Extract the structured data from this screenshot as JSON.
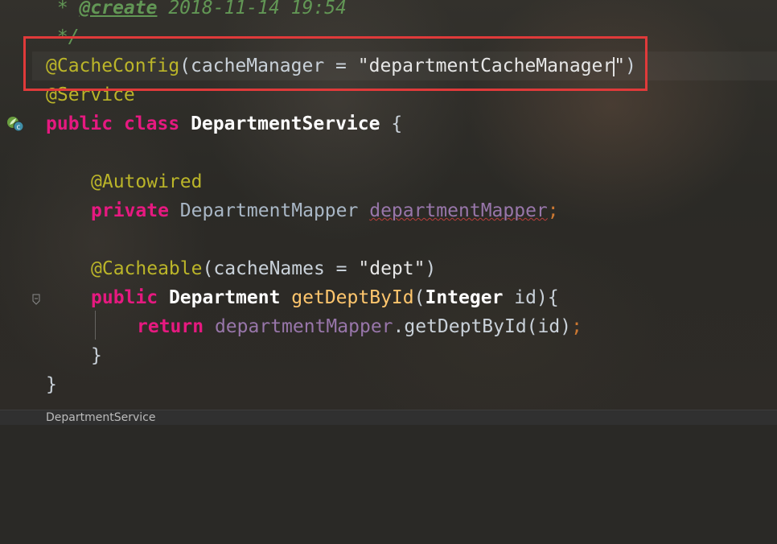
{
  "editor": {
    "lines": {
      "comment_create": {
        "prefix": " * ",
        "tag": "@create",
        "date": " 2018-11-14 19:54"
      },
      "comment_end": " */",
      "cache_config": {
        "annot": "@CacheConfig",
        "open": "(",
        "param": "cacheManager",
        "eq": " = ",
        "str_before_caret": "\"departmentCacheManager",
        "str_after_caret": "\"",
        "close": ")"
      },
      "service": "@Service",
      "class_decl": {
        "kw1": "public",
        "kw2": "class",
        "name": "DepartmentService",
        "brace": "{"
      },
      "autowired": "@Autowired",
      "field_decl": {
        "kw": "private",
        "type": "DepartmentMapper",
        "name": "departmentMapper",
        "semi": ";"
      },
      "cacheable": {
        "annot": "@Cacheable",
        "open": "(",
        "param": "cacheNames",
        "eq": " = ",
        "str": "\"dept\"",
        "close": ")"
      },
      "method_decl": {
        "kw": "public",
        "type": "Department",
        "name": "getDeptById",
        "open": "(",
        "ptype": "Integer",
        "pname": " id",
        "close": "){"
      },
      "return_stmt": {
        "kw": "return",
        "field": "departmentMapper",
        "call": ".getDeptById(id)",
        "semi": ";"
      },
      "method_close": "}",
      "class_close": "}"
    }
  },
  "statusbar": {
    "breadcrumb": "DepartmentService"
  },
  "colors": {
    "highlight_box": "#e03a3a",
    "keyword": "#e61980",
    "annotation": "#bbb529",
    "comment": "#629755",
    "field": "#9876aa",
    "method": "#ffc66d"
  },
  "icons": {
    "gutter_marker": "spring-bean-class-icon",
    "fold": "fold-marker-icon"
  }
}
